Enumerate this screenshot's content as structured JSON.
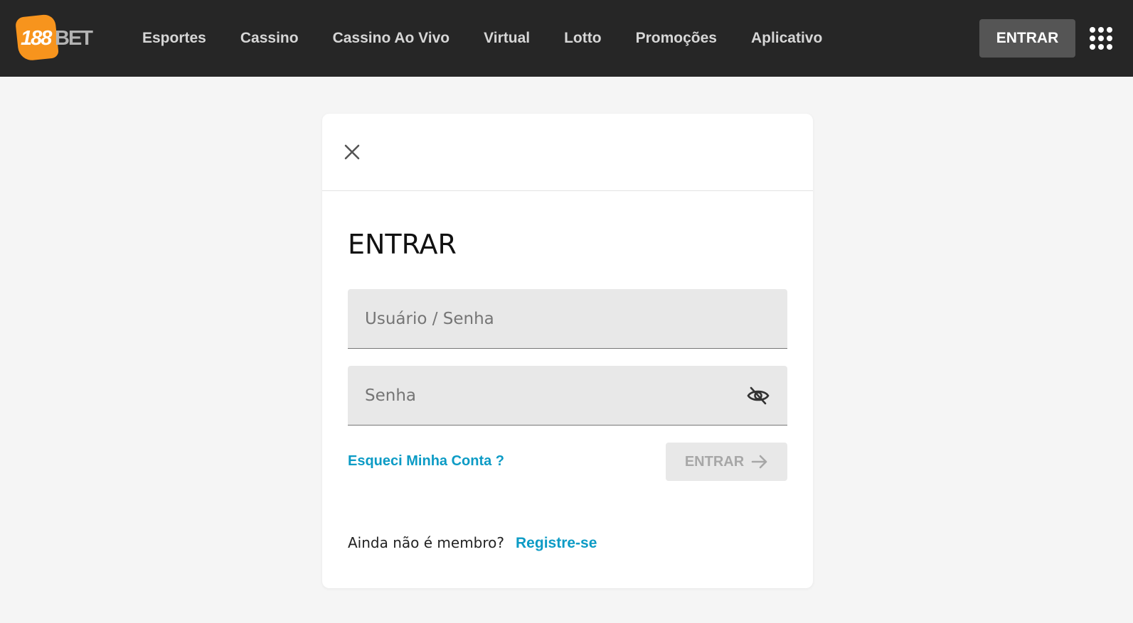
{
  "header": {
    "logo": {
      "number": "188",
      "text": "BET",
      "brand_color": "#f7941d"
    },
    "nav": [
      {
        "label": "Esportes"
      },
      {
        "label": "Cassino"
      },
      {
        "label": "Cassino Ao Vivo"
      },
      {
        "label": "Virtual"
      },
      {
        "label": "Lotto"
      },
      {
        "label": "Promoções"
      },
      {
        "label": "Aplicativo"
      }
    ],
    "login_button": "ENTRAR",
    "menu_icon": "grid-menu-icon"
  },
  "login_modal": {
    "close_icon": "close-icon",
    "title": "ENTRAR",
    "username_placeholder": "Usuário / Senha",
    "username_value": "",
    "password_placeholder": "Senha",
    "password_value": "",
    "password_toggle_icon": "eye-slash-icon",
    "forgot_link": "Esqueci Minha Conta ?",
    "submit_button": "ENTRAR",
    "submit_icon": "arrow-right-icon",
    "not_member_text": "Ainda não é membro?",
    "register_link": "Registre-se",
    "link_color": "#0c9bc5"
  }
}
